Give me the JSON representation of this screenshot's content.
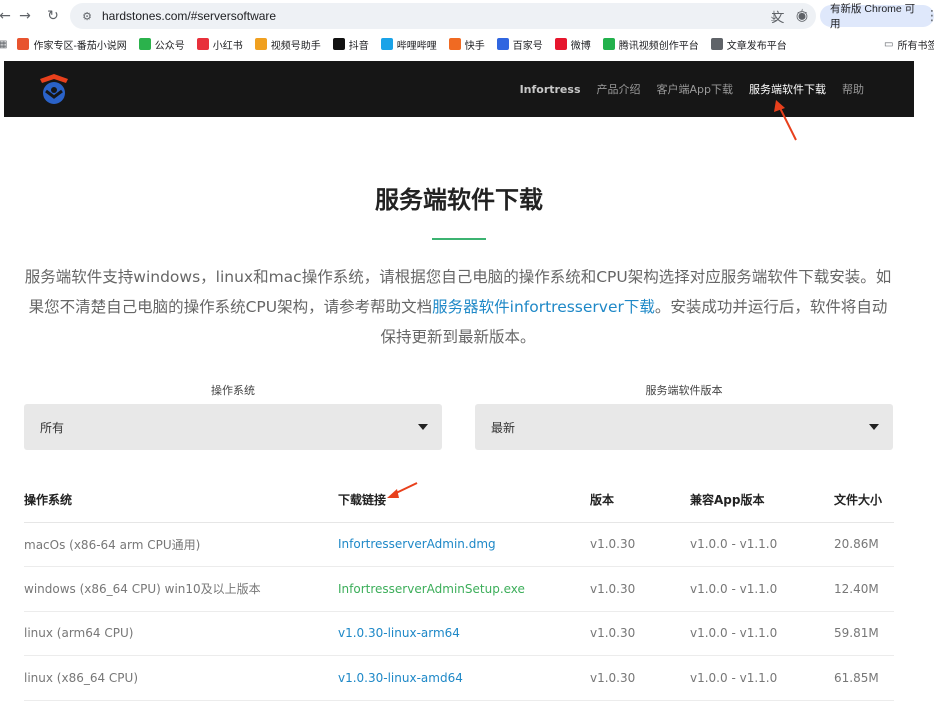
{
  "browser": {
    "url": "hardstones.com/#serversoftware",
    "update_label": "有新版 Chrome 可用",
    "bookmarks": [
      {
        "label": "作家专区-番茄小说网",
        "color": "#e8542f"
      },
      {
        "label": "公众号",
        "color": "#2bb24c"
      },
      {
        "label": "小红书",
        "color": "#e8303b"
      },
      {
        "label": "视频号助手",
        "color": "#f0a020"
      },
      {
        "label": "抖音",
        "color": "#111111"
      },
      {
        "label": "哔哩哔哩",
        "color": "#1aa3e8"
      },
      {
        "label": "快手",
        "color": "#f06a22"
      },
      {
        "label": "百家号",
        "color": "#3066e0"
      },
      {
        "label": "微博",
        "color": "#e6162d"
      },
      {
        "label": "腾讯视频创作平台",
        "color": "#22b14c"
      },
      {
        "label": "文章发布平台",
        "color": "#5f6368"
      }
    ],
    "all_bookmarks_label": "所有书签"
  },
  "site": {
    "nav": {
      "brand": "Infortress",
      "product": "产品介绍",
      "client": "客户端App下载",
      "server": "服务端软件下载",
      "help": "帮助"
    }
  },
  "main": {
    "title": "服务端软件下载",
    "intro_before": "服务端软件支持windows，linux和mac操作系统，请根据您自己电脑的操作系统和CPU架构选择对应服务端软件下载安装。如果您不清楚自己电脑的操作系统CPU架构，请参考帮助文档",
    "intro_link": "服务器软件infortresserver下载",
    "intro_after": "。安装成功并运行后，软件将自动保持更新到最新版本。"
  },
  "filters": {
    "os_label": "操作系统",
    "os_value": "所有",
    "version_label": "服务端软件版本",
    "version_value": "最新"
  },
  "table": {
    "headers": [
      "操作系统",
      "下载链接",
      "版本",
      "兼容App版本",
      "文件大小"
    ],
    "rows": [
      {
        "os": "macOs (x86-64 arm CPU通用)",
        "link": "InfortresserverAdmin.dmg",
        "link_color": "blue",
        "version": "v1.0.30",
        "compat": "v1.0.0 - v1.1.0",
        "size": "20.86M"
      },
      {
        "os": "windows (x86_64 CPU) win10及以上版本",
        "link": "InfortresserverAdminSetup.exe",
        "link_color": "green",
        "version": "v1.0.30",
        "compat": "v1.0.0 - v1.1.0",
        "size": "12.40M"
      },
      {
        "os": "linux (arm64 CPU)",
        "link": "v1.0.30-linux-arm64",
        "link_color": "blue",
        "version": "v1.0.30",
        "compat": "v1.0.0 - v1.1.0",
        "size": "59.81M"
      },
      {
        "os": "linux (x86_64 CPU)",
        "link": "v1.0.30-linux-amd64",
        "link_color": "blue",
        "version": "v1.0.30",
        "compat": "v1.0.0 - v1.1.0",
        "size": "61.85M"
      }
    ]
  },
  "colors": {
    "accent_link": "#1e88c7",
    "accent_green": "#3cae5a",
    "annotation_arrow": "#e8401c",
    "header_bg": "#161616"
  }
}
